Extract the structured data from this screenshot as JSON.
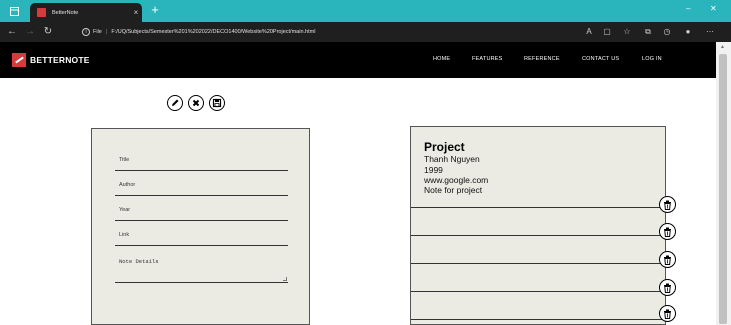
{
  "browser": {
    "tab_title": "BetterNote",
    "tab_close": "×",
    "new_tab": "+",
    "url_scheme": "File",
    "url_path": "F:/UQ/Subjects/Semester%201%202022/DECO1400/Website%20Project/main.html",
    "window_min": "–",
    "window_close": "✕"
  },
  "site": {
    "logo_text": "BETTERNOTE",
    "nav": [
      "HOME",
      "FEATURES",
      "REFERENCE",
      "CONTACT US",
      "LOG IN"
    ]
  },
  "form": {
    "fields": [
      "Title",
      "Author",
      "Year",
      "Link"
    ],
    "details_label": "Note Details"
  },
  "note": {
    "title": "Project",
    "author": "Thanh Nguyen",
    "year": "1999",
    "link": "www.google.com",
    "details": "Note for project"
  },
  "icons": {
    "accent": "#d63b3b",
    "tabstrip": "#2ab5bd",
    "action_edit": "pencil-icon",
    "action_clear": "close-icon",
    "action_save": "save-icon",
    "row_delete": "trash-icon"
  }
}
